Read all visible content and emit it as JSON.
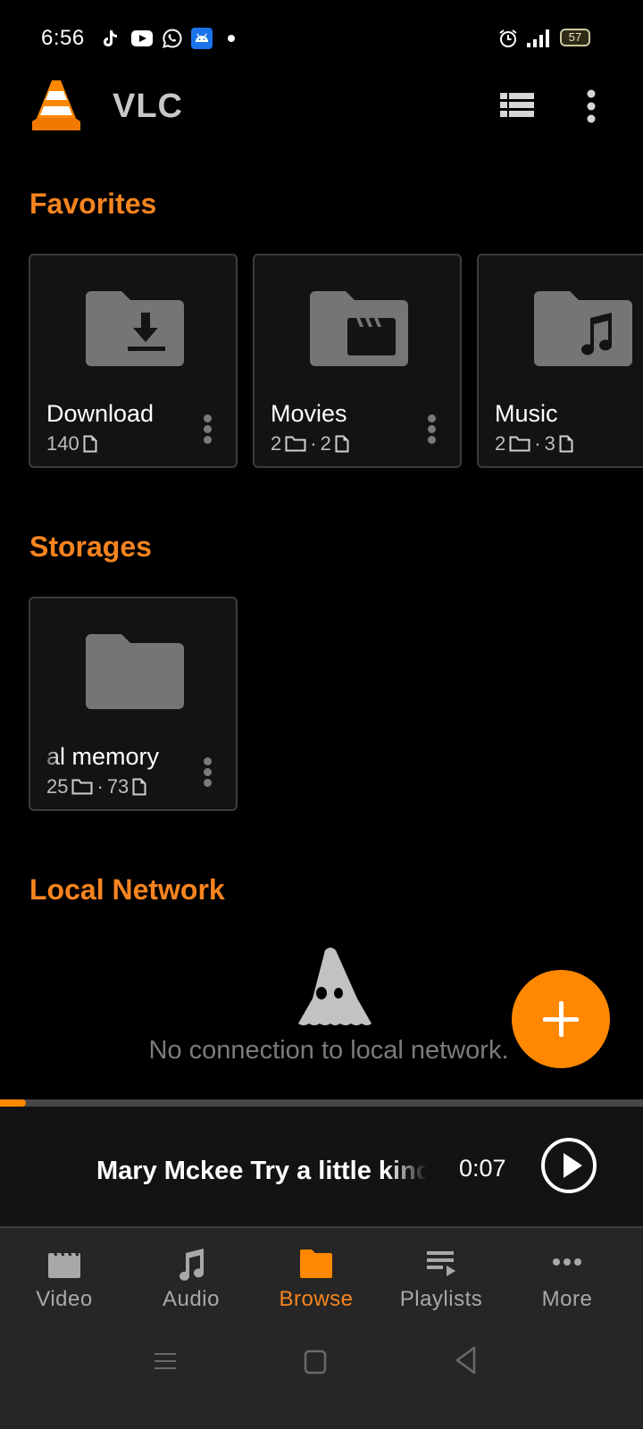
{
  "status_bar": {
    "time": "6:56",
    "notification_icons": [
      "tiktok-icon",
      "youtube-icon",
      "whatsapp-icon",
      "android-icon",
      "dot-icon"
    ],
    "right_icons": [
      "alarm-icon",
      "signal-icon",
      "battery-icon"
    ],
    "battery_level": "57"
  },
  "app_bar": {
    "title": "VLC",
    "actions": [
      "view-mode-icon",
      "overflow-menu-icon"
    ]
  },
  "sections": {
    "favorites": {
      "title": "Favorites",
      "items": [
        {
          "name": "Download",
          "folders": null,
          "files": "140",
          "icon": "folder-download-icon"
        },
        {
          "name": "Movies",
          "folders": "2",
          "files": "2",
          "icon": "folder-movies-icon"
        },
        {
          "name": "Music",
          "folders": "2",
          "files": "3",
          "icon": "folder-music-icon"
        }
      ]
    },
    "storages": {
      "title": "Storages",
      "items": [
        {
          "name": "al memory",
          "folders": "25",
          "files": "73",
          "icon": "folder-icon"
        }
      ]
    },
    "local_network": {
      "title": "Local Network",
      "empty_message": "No connection to local network."
    }
  },
  "separator": "·",
  "fab": {
    "icon": "plus-icon"
  },
  "mini_player": {
    "title": "Mary Mckee Try a little kindness",
    "time": "0:07",
    "progress_fraction": 0.04
  },
  "bottom_nav": {
    "active": "Browse",
    "items": [
      {
        "label": "Video",
        "icon": "video-clapper-icon"
      },
      {
        "label": "Audio",
        "icon": "music-note-icon"
      },
      {
        "label": "Browse",
        "icon": "folder-icon"
      },
      {
        "label": "Playlists",
        "icon": "playlist-icon"
      },
      {
        "label": "More",
        "icon": "more-dots-icon"
      }
    ]
  },
  "colors": {
    "accent": "#ff8800",
    "section_title": "#f7841f",
    "background": "#000000",
    "card_background": "#131313",
    "nav_background": "#262626"
  }
}
